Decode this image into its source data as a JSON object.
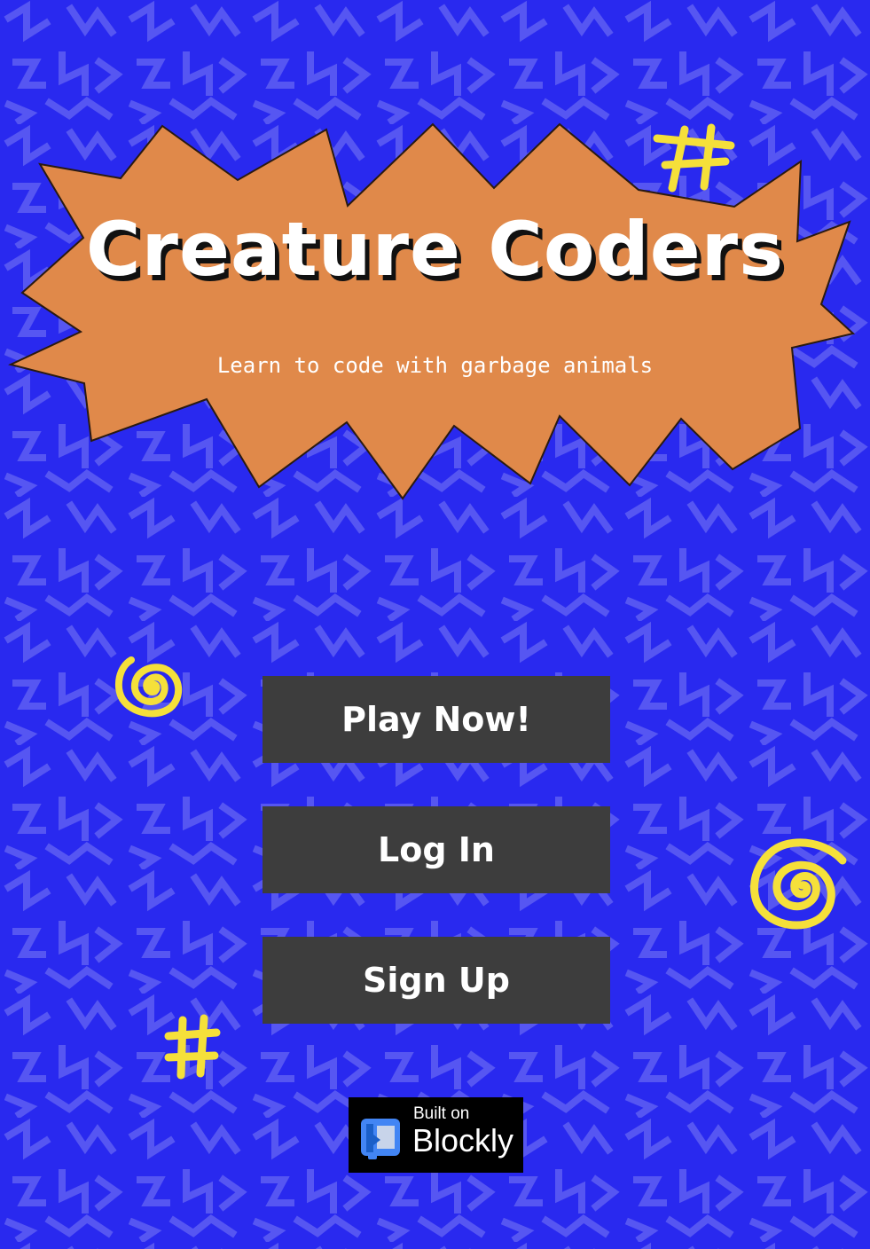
{
  "app": {
    "title": "Creature Coders",
    "subtitle": "Learn to code with garbage animals"
  },
  "buttons": {
    "play": "Play Now!",
    "login": "Log In",
    "signup": "Sign Up"
  },
  "badge": {
    "top_text": "Built on",
    "main_text": "Blockly"
  },
  "colors": {
    "background": "#2929ef",
    "pattern": "#5656f2",
    "burst": "#e0894a",
    "button": "#3d3d3d",
    "accent": "#f5e03a"
  },
  "icons": [
    "squiggle-pattern",
    "spiral-icon",
    "hash-icon",
    "blockly-logo-icon"
  ]
}
